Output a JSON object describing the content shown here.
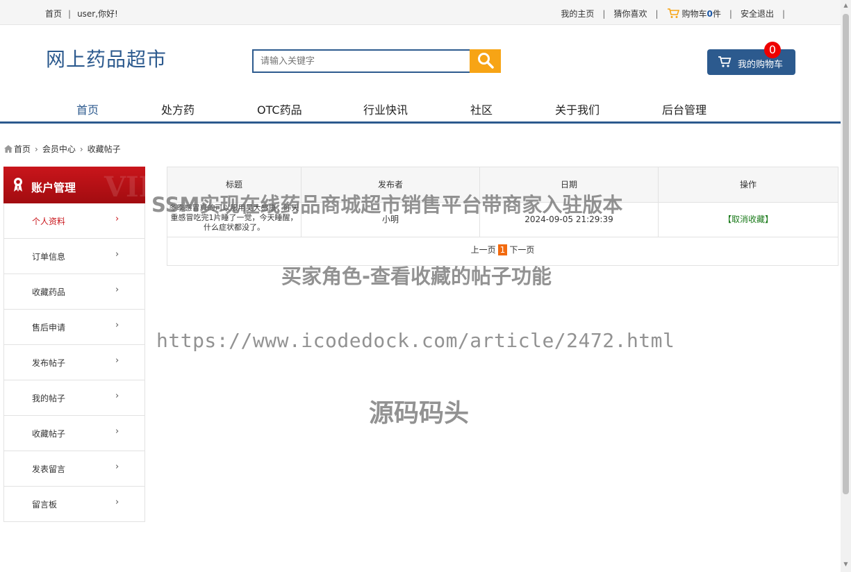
{
  "topbar": {
    "home": "首页",
    "greeting": "user,你好!",
    "my_home": "我的主页",
    "guess": "猜你喜欢",
    "cart_prefix": "购物车",
    "cart_count": "0",
    "cart_suffix": "件",
    "logout": "安全退出"
  },
  "header": {
    "logo": "网上药品超市",
    "search_placeholder": "请输入关键字",
    "cart_button": "我的购物车",
    "cart_badge": "0"
  },
  "nav": [
    "首页",
    "处方药",
    "OTC药品",
    "行业快讯",
    "社区",
    "关于我们",
    "后台管理"
  ],
  "breadcrumb": [
    "首页",
    "会员中心",
    "收藏帖子"
  ],
  "sidebar": {
    "title": "账户管理",
    "watermark": "VIP",
    "items": [
      {
        "label": "个人资料"
      },
      {
        "label": "订单信息"
      },
      {
        "label": "收藏药品"
      },
      {
        "label": "售后申请"
      },
      {
        "label": "发布帖子"
      },
      {
        "label": "我的帖子"
      },
      {
        "label": "收藏帖子"
      },
      {
        "label": "发表留言"
      },
      {
        "label": "留言板"
      }
    ]
  },
  "table": {
    "headers": [
      "标题",
      "发布者",
      "日期",
      "操作"
    ],
    "rows": [
      {
        "title": "冬季感冒真的可以服用吴大感康，昨天重感冒吃完1片睡了一觉，今天睡醒，什么症状都没了。",
        "author": "小明",
        "date": "2024-09-05 21:29:39",
        "action": "【取消收藏】"
      }
    ],
    "pager": {
      "prev": "上一页",
      "current": "1",
      "next": "下一页"
    }
  },
  "watermarks": {
    "line1": "SSM实现在线药品商城超市销售平台带商家入驻版本",
    "line2": "买家角色-查看收藏的帖子功能",
    "line3": "https://www.icodedock.com/article/2472.html",
    "line4": "源码码头"
  },
  "colors": {
    "primary": "#2c5a8e",
    "accent": "#f7a415",
    "sidebar_head": "#c9151b",
    "active_page": "#f26a0f"
  }
}
